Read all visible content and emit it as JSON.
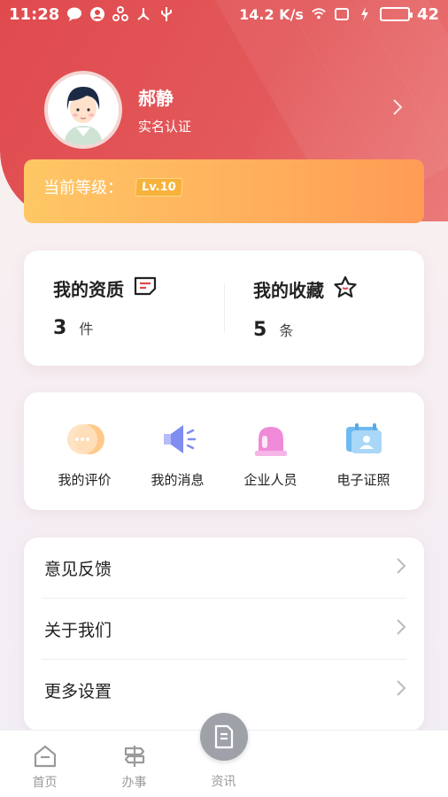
{
  "status_bar": {
    "time": "11:28",
    "net_speed": "14.2 K/s",
    "battery": "42"
  },
  "profile": {
    "name": "郝静",
    "verification": "实名认证"
  },
  "level": {
    "label": "当前等级：",
    "badge": "Lv.10"
  },
  "stats": {
    "qualification": {
      "title": "我的资质",
      "count": "3",
      "unit": "件"
    },
    "favorites": {
      "title": "我的收藏",
      "count": "5",
      "unit": "条"
    }
  },
  "quick": [
    {
      "label": "我的评价",
      "icon": "chat-bubble-icon"
    },
    {
      "label": "我的消息",
      "icon": "megaphone-icon"
    },
    {
      "label": "企业人员",
      "icon": "alarm-icon"
    },
    {
      "label": "电子证照",
      "icon": "certificate-icon"
    }
  ],
  "menu": [
    {
      "label": "意见反馈"
    },
    {
      "label": "关于我们"
    },
    {
      "label": "更多设置"
    }
  ],
  "tabs": {
    "home": "首页",
    "affairs": "办事",
    "news": "资讯"
  },
  "colors": {
    "header_red": "#e04a4e",
    "level_orange": "#ffae5c",
    "battery_green": "#3fd24c"
  }
}
